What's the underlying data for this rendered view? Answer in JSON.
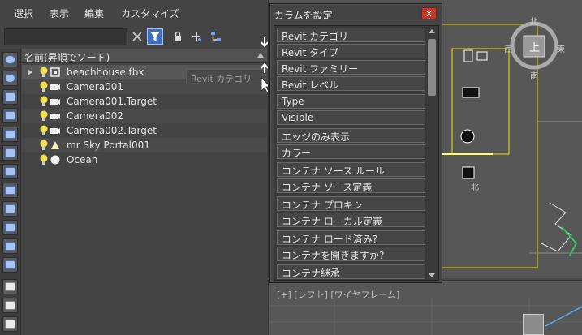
{
  "menu": {
    "items": [
      "選択",
      "表示",
      "編集",
      "カスタマイズ"
    ]
  },
  "toolbar": {
    "search_value": "",
    "icons": [
      "clear-search-icon",
      "filter-icon",
      "lock-icon",
      "add-link-icon",
      "hierarchy-icon"
    ]
  },
  "scene_list": {
    "header": "名前(昇順でソート)",
    "rows": [
      {
        "name": "beachhouse.fbx",
        "icon": "container-icon",
        "expandable": true
      },
      {
        "name": "Camera001",
        "icon": "camera-icon",
        "expandable": false
      },
      {
        "name": "Camera001.Target",
        "icon": "camera-icon",
        "expandable": false
      },
      {
        "name": "Camera002",
        "icon": "camera-icon",
        "expandable": false
      },
      {
        "name": "Camera002.Target",
        "icon": "camera-icon",
        "expandable": false
      },
      {
        "name": "mr Sky Portal001",
        "icon": "light-icon",
        "expandable": false
      },
      {
        "name": "Ocean",
        "icon": "sphere-icon",
        "expandable": false
      }
    ]
  },
  "drag_ghost": {
    "label": "Revit カテゴリ"
  },
  "column_dialog": {
    "title": "カラムを設定",
    "close_label": "x",
    "items": [
      "Revit カテゴリ",
      "Revit タイプ",
      "Revit ファミリー",
      "Revit レベル",
      "Type",
      "Visible",
      "エッジのみ表示",
      "カラー",
      "コンテナ ソース ルール",
      "コンテナ ソース定義",
      "コンテナ プロキシ",
      "コンテナ ローカル定義",
      "コンテナ ロード済み?",
      "コンテナを開きますか?",
      "コンテナ継承"
    ]
  },
  "viewport": {
    "label": "[+] [レフト] [ワイヤフレーム]",
    "viewcube": {
      "top": "上",
      "north": "北",
      "south": "南",
      "east": "東",
      "west": "西"
    }
  },
  "colors": {
    "panel_bg": "#444444",
    "viewport_bg": "#575757",
    "wire_yellow": "#e8e400",
    "close_red": "#c0392b"
  }
}
